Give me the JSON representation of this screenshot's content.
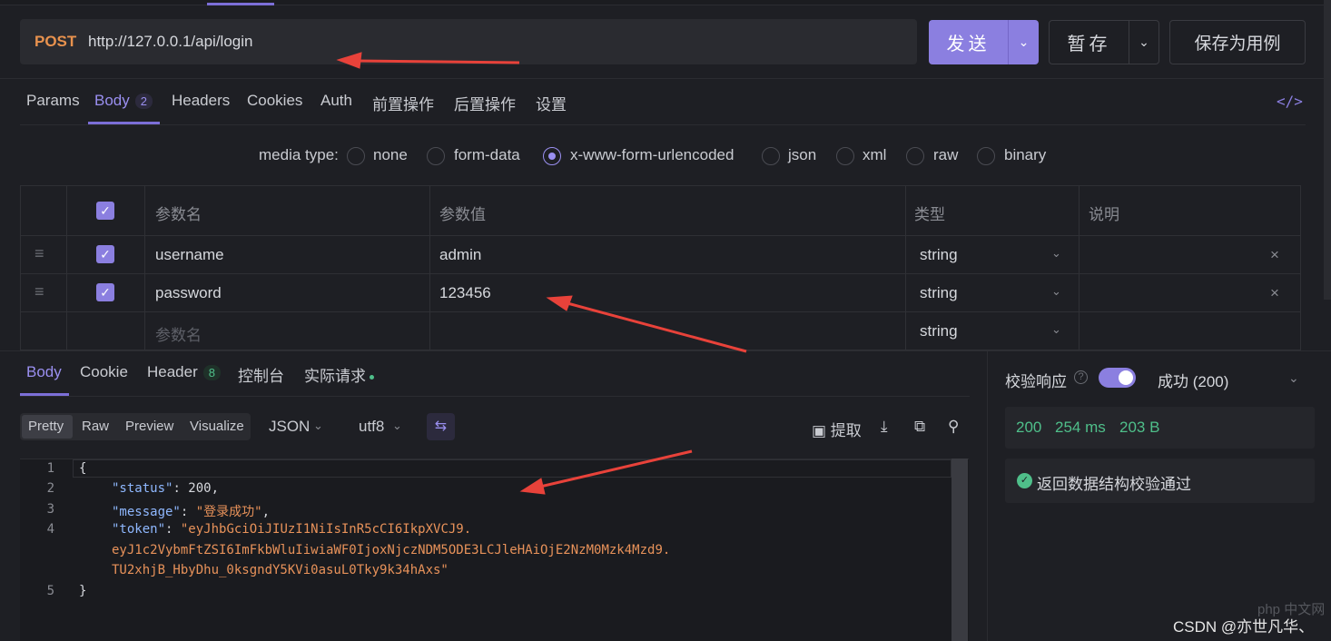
{
  "request": {
    "method": "POST",
    "url": "http://127.0.0.1/api/login",
    "send_label": "发送",
    "save_label": "暂存",
    "save_example_label": "保存为用例"
  },
  "req_tabs": [
    {
      "label": "Params"
    },
    {
      "label": "Body",
      "badge": "2"
    },
    {
      "label": "Headers"
    },
    {
      "label": "Cookies"
    },
    {
      "label": "Auth"
    },
    {
      "label": "前置操作"
    },
    {
      "label": "后置操作"
    },
    {
      "label": "设置"
    }
  ],
  "code_icon": "</>",
  "media": {
    "label": "media type:",
    "options": [
      "none",
      "form-data",
      "x-www-form-urlencoded",
      "json",
      "xml",
      "raw",
      "binary"
    ],
    "selected": "x-www-form-urlencoded"
  },
  "params": {
    "headers": [
      "参数名",
      "参数值",
      "类型",
      "说明"
    ],
    "rows": [
      {
        "name": "username",
        "value": "admin",
        "type": "string"
      },
      {
        "name": "password",
        "value": "123456",
        "type": "string"
      }
    ],
    "new_row": {
      "name_placeholder": "参数名",
      "type": "string"
    }
  },
  "resp_tabs": [
    {
      "label": "Body"
    },
    {
      "label": "Cookie"
    },
    {
      "label": "Header",
      "badge": "8"
    },
    {
      "label": "控制台"
    },
    {
      "label": "实际请求"
    }
  ],
  "view_modes": [
    "Pretty",
    "Raw",
    "Preview",
    "Visualize"
  ],
  "format": "JSON",
  "encoding": "utf8",
  "extract_label": "提取",
  "code": {
    "line_numbers": [
      "1",
      "2",
      "3",
      "4",
      "5"
    ],
    "open_brace": "{",
    "close_brace": "}",
    "status_key": "\"status\"",
    "status_val": "200",
    "message_key": "\"message\"",
    "message_val": "\"登录成功\"",
    "token_key": "\"token\"",
    "token_line1": "\"eyJhbGciOiJIUzI1NiIsInR5cCI6IkpXVCJ9.",
    "token_line2": "eyJ1c2VybmFtZSI6ImFkbWluIiwiaWF0IjoxNjczNDM5ODE3LCJleHAiOjE2NzM0Mzk4Mzd9.",
    "token_line3": "TU2xhjB_HbyDhu_0ksgndY5KVi0asuL0Tky9k34hAxs\""
  },
  "verify": {
    "label": "校验响应",
    "result": "成功 (200)",
    "status_code": "200",
    "time": "254 ms",
    "size": "203 B",
    "message": "返回数据结构校验通过"
  },
  "watermark": "CSDN @亦世凡华、",
  "watermark_logo": "php 中文网"
}
